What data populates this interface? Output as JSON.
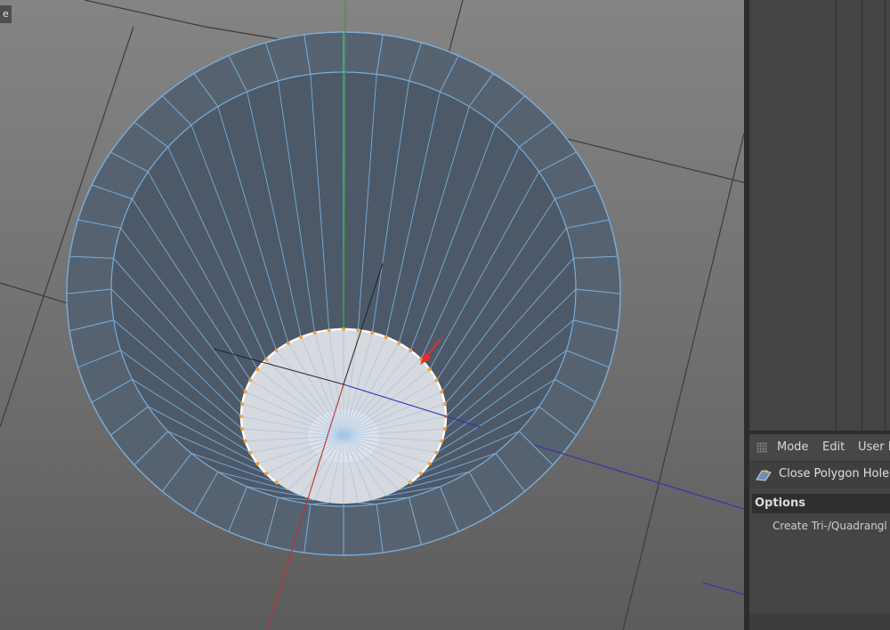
{
  "viewport": {
    "view_tag": "e",
    "icons": {
      "arrow": "red-arrow-icon"
    },
    "colors": {
      "background_top": "#848484",
      "background_bottom": "#5c5c5c",
      "mesh_fill": "#566270",
      "mesh_fill_inner": "#4d5968",
      "mesh_edge": "#7aaedc",
      "cap_fill": "#d6d9dd",
      "cap_edge": "#a8c8e8",
      "border_edge": "#ffffff",
      "border_points": "#f0a040",
      "axis_x": "#c03030",
      "axis_y": "#30a030",
      "axis_z": "#3030b0",
      "grid": "#3c3c3c",
      "arrow": "#e03028"
    }
  },
  "attribute_manager": {
    "menu": [
      "Mode",
      "Edit",
      "User D"
    ],
    "tool": {
      "icon": "close-polygon-hole-icon",
      "label": "Close Polygon Hole"
    },
    "options_header": "Options",
    "options": [
      {
        "label": "Create Tri-/Quadrangl"
      }
    ]
  }
}
